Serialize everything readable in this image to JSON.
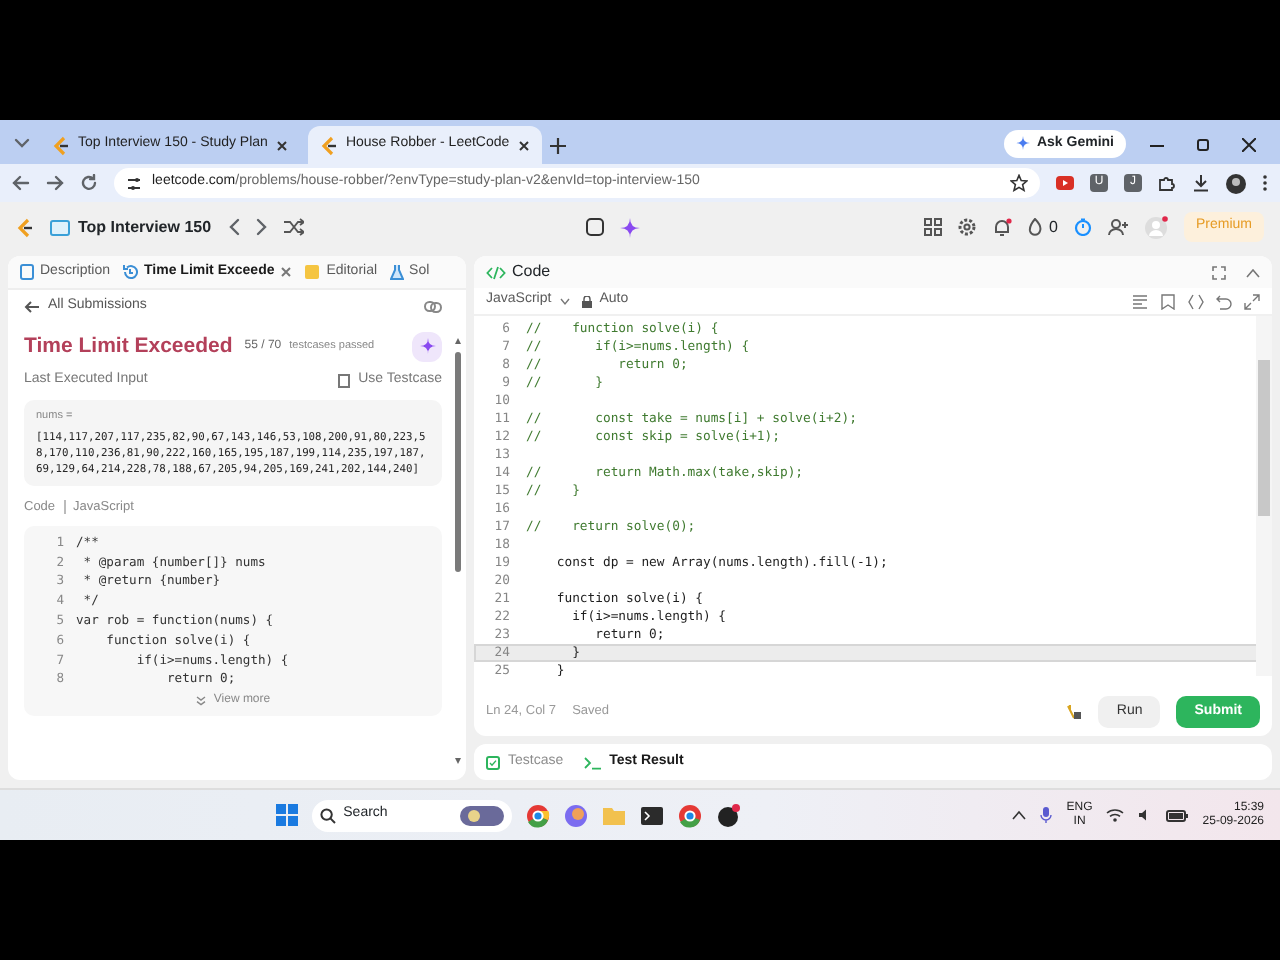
{
  "browser": {
    "tabs": [
      {
        "title": "Top Interview 150 - Study Plan",
        "selected": false
      },
      {
        "title": "House Robber - LeetCode",
        "selected": true
      }
    ],
    "ask_gemini": "Ask Gemini",
    "url_host": "leetcode.com",
    "url_path": "/problems/house-robber/?envType=study-plan-v2&envId=top-interview-150",
    "extensions": [
      "U",
      "J"
    ]
  },
  "navbar": {
    "list_title": "Top Interview 150",
    "streak": "0",
    "premium": "Premium"
  },
  "left_panel": {
    "tabs": [
      {
        "label": "Description",
        "selected": false
      },
      {
        "label": "Time Limit Exceede",
        "selected": true
      },
      {
        "label": "Editorial",
        "selected": false
      },
      {
        "label": "Sol",
        "selected": false
      }
    ],
    "back_link": "All Submissions",
    "verdict": "Time Limit Exceeded",
    "passed": "55 / 70",
    "passed_label": "testcases passed",
    "last_input_label": "Last Executed Input",
    "use_testcase": "Use Testcase",
    "input_name": "nums =",
    "input_value": "[114,117,207,117,235,82,90,67,143,146,53,108,200,91,80,223,58,170,110,236,81,90,222,160,165,195,187,199,114,235,197,187,69,129,64,214,228,78,188,67,205,94,205,169,241,202,144,240]",
    "code_label": "Code",
    "code_language": "JavaScript",
    "code_lines": [
      {
        "number": "1",
        "text": "/**"
      },
      {
        "number": "2",
        "text": " * @param {number[]} nums"
      },
      {
        "number": "3",
        "text": " * @return {number}"
      },
      {
        "number": "4",
        "text": " */"
      },
      {
        "number": "5",
        "text": "var rob = function(nums) {"
      },
      {
        "number": "6",
        "text": "    function solve(i) {"
      },
      {
        "number": "7",
        "text": "        if(i>=nums.length) {"
      },
      {
        "number": "8",
        "text": "            return 0;"
      }
    ],
    "view_more": "View more"
  },
  "editor": {
    "title": "Code",
    "language": "JavaScript",
    "mode": "Auto",
    "lines": [
      {
        "number": "6",
        "kind": "comment",
        "text": "//    function solve(i) {",
        "current": false
      },
      {
        "number": "7",
        "kind": "comment",
        "text": "//       if(i>=nums.length) {",
        "current": false
      },
      {
        "number": "8",
        "kind": "comment",
        "text": "//          return 0;",
        "current": false
      },
      {
        "number": "9",
        "kind": "comment",
        "text": "//       }",
        "current": false
      },
      {
        "number": "10",
        "current": false
      },
      {
        "number": "11",
        "kind": "comment",
        "text": "//       const take = nums[i] + solve(i+2);",
        "current": false
      },
      {
        "number": "12",
        "kind": "comment",
        "text": "//       const skip = solve(i+1);",
        "current": false
      },
      {
        "number": "13",
        "current": false
      },
      {
        "number": "14",
        "kind": "comment",
        "text": "//       return Math.max(take,skip);",
        "current": false
      },
      {
        "number": "15",
        "kind": "comment",
        "text": "//    }",
        "current": false
      },
      {
        "number": "16",
        "current": false
      },
      {
        "number": "17",
        "kind": "comment",
        "text": "//    return solve(0);",
        "current": false
      },
      {
        "number": "18",
        "current": false
      },
      {
        "number": "19",
        "kind": "code",
        "text": "    const dp = new Array(nums.length).fill(-1);",
        "current": false
      },
      {
        "number": "20",
        "current": false
      },
      {
        "number": "21",
        "kind": "code",
        "text": "    function solve(i) {",
        "current": false
      },
      {
        "number": "22",
        "kind": "code",
        "text": "      if(i>=nums.length) {",
        "current": false
      },
      {
        "number": "23",
        "kind": "code",
        "text": "         return 0;",
        "current": false
      },
      {
        "number": "24",
        "kind": "code",
        "text": "      }",
        "current": true
      },
      {
        "number": "25",
        "kind": "code",
        "text": "    }",
        "current": false
      }
    ],
    "status": "Ln 24, Col 7",
    "saved": "Saved",
    "run": "Run",
    "submit": "Submit"
  },
  "bottom_tabs": [
    {
      "label": "Testcase",
      "selected": false
    },
    {
      "label": "Test Result",
      "selected": true
    }
  ],
  "taskbar": {
    "search": "Search",
    "language": "ENG",
    "region": "IN",
    "time": "15:39",
    "date": "25-09-2026"
  }
}
